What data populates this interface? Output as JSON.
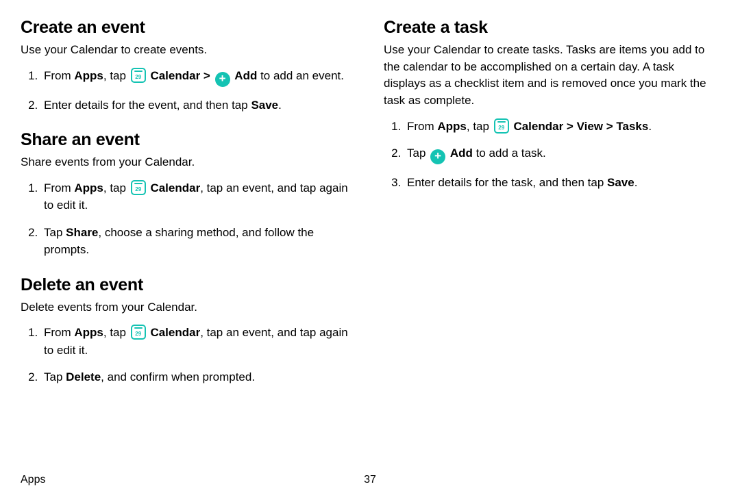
{
  "footer": {
    "section": "Apps",
    "page": "37"
  },
  "left": {
    "create": {
      "heading": "Create an event",
      "intro": "Use your Calendar to create events.",
      "step1_pre": "From ",
      "step1_apps": "Apps",
      "step1_tap": ", tap ",
      "step1_cal": "Calendar",
      "step1_chev": " > ",
      "step1_add": "Add",
      "step1_post": " to add an event.",
      "step2_pre": "Enter details for the event, and then tap ",
      "step2_save": "Save",
      "step2_post": "."
    },
    "share": {
      "heading": "Share an event",
      "intro": "Share events from your Calendar.",
      "step1_pre": "From ",
      "step1_apps": "Apps",
      "step1_tap": ", tap ",
      "step1_cal": "Calendar",
      "step1_post": ", tap an event, and tap again to edit it.",
      "step2_pre": "Tap ",
      "step2_share": "Share",
      "step2_post": ", choose a sharing method, and follow the prompts."
    },
    "delete": {
      "heading": "Delete an event",
      "intro": "Delete events from your Calendar.",
      "step1_pre": "From ",
      "step1_apps": "Apps",
      "step1_tap": ", tap ",
      "step1_cal": "Calendar",
      "step1_post": ", tap an event, and tap again to edit it.",
      "step2_pre": "Tap ",
      "step2_delete": "Delete",
      "step2_post": ", and confirm when prompted."
    }
  },
  "right": {
    "task": {
      "heading": "Create a task",
      "intro": "Use your Calendar to create tasks. Tasks are items you add to the calendar to be accomplished on a certain day. A task displays as a checklist item and is removed once you mark the task as complete.",
      "step1_pre": "From ",
      "step1_apps": "Apps",
      "step1_tap": ", tap ",
      "step1_cal": "Calendar",
      "step1_chev1": " > ",
      "step1_view": "View",
      "step1_chev2": " > ",
      "step1_tasks": "Tasks",
      "step1_post": ".",
      "step2_pre": "Tap ",
      "step2_add": "Add",
      "step2_post": " to add a task.",
      "step3_pre": "Enter details for the task, and then tap ",
      "step3_save": "Save",
      "step3_post": "."
    }
  }
}
